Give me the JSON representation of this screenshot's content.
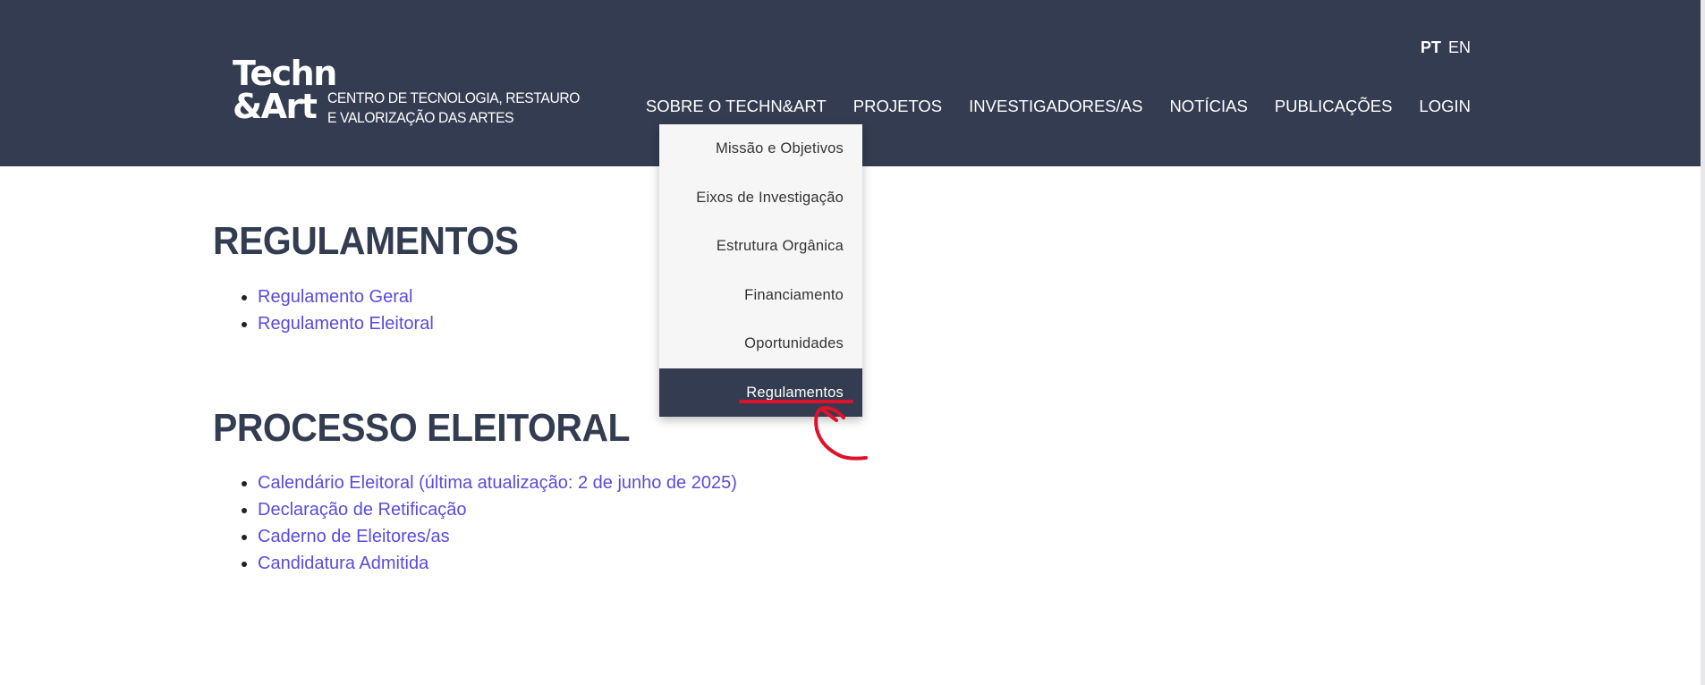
{
  "logo": {
    "mark_line1": "Techn",
    "mark_line2": "&Art",
    "text_line1": "CENTRO DE TECNOLOGIA, RESTAURO",
    "text_line2": "E VALORIZAÇÃO DAS ARTES"
  },
  "lang": {
    "pt": "PT",
    "en": "EN",
    "active": "PT"
  },
  "nav": {
    "items": [
      {
        "label": "SOBRE O TECHN&ART"
      },
      {
        "label": "PROJETOS"
      },
      {
        "label": "INVESTIGADORES/AS"
      },
      {
        "label": "NOTÍCIAS"
      },
      {
        "label": "PUBLICAÇÕES"
      },
      {
        "label": "LOGIN"
      }
    ]
  },
  "dropdown": {
    "items": [
      {
        "label": "Missão e Objetivos"
      },
      {
        "label": "Eixos de Investigação"
      },
      {
        "label": "Estrutura Orgânica"
      },
      {
        "label": "Financiamento"
      },
      {
        "label": "Oportunidades"
      },
      {
        "label": "Regulamentos"
      }
    ],
    "selected": "Regulamentos"
  },
  "sections": [
    {
      "title": "REGULAMENTOS",
      "links": [
        {
          "label": "Regulamento Geral"
        },
        {
          "label": "Regulamento Eleitoral"
        }
      ]
    },
    {
      "title": "PROCESSO ELEITORAL",
      "links": [
        {
          "label": "Calendário Eleitoral (última atualização: 2 de junho de 2025)"
        },
        {
          "label": "Declaração de Retificação"
        },
        {
          "label": "Caderno de Eleitores/as"
        },
        {
          "label": "Candidatura Admitida"
        }
      ]
    }
  ],
  "colors": {
    "header_bg": "#333c51",
    "link": "#5a4bdc",
    "annotation": "#e0112b"
  }
}
